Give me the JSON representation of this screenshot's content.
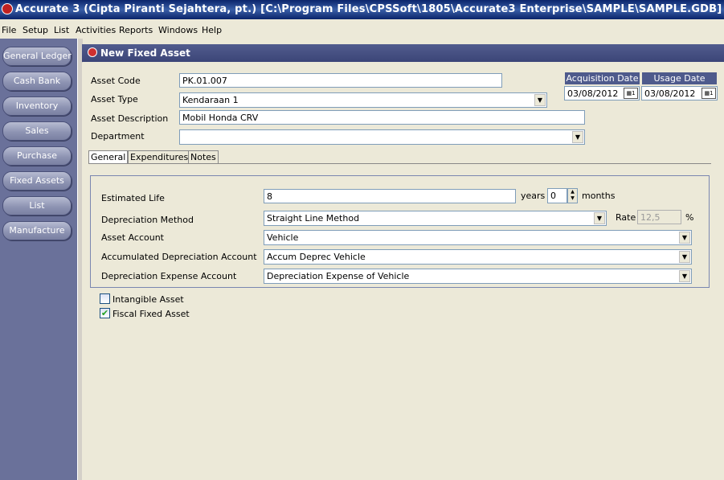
{
  "window": {
    "title": "Accurate 3  (Cipta Piranti Sejahtera, pt.)  [C:\\Program Files\\CPSSoft\\1805\\Accurate3 Enterprise\\SAMPLE\\SAMPLE.GDB]"
  },
  "menu": [
    "File",
    "Setup",
    "List",
    "Activities",
    "Reports",
    "Windows",
    "Help"
  ],
  "sidebar": {
    "items": [
      "General Ledger",
      "Cash Bank",
      "Inventory",
      "Sales",
      "Purchase",
      "Fixed Assets",
      "List",
      "Manufacture"
    ]
  },
  "form": {
    "title": "New Fixed Asset",
    "asset_code_label": "Asset Code",
    "asset_code": "PK.01.007",
    "asset_type_label": "Asset Type",
    "asset_type": "Kendaraan 1",
    "asset_description_label": "Asset Description",
    "asset_description": "Mobil Honda CRV",
    "department_label": "Department",
    "department": "",
    "acquisition_date_label": "Acquisition Date",
    "acquisition_date": "03/08/2012",
    "usage_date_label": "Usage Date",
    "usage_date": "03/08/2012",
    "tabs": [
      "General",
      "Expenditures",
      "Notes"
    ],
    "general": {
      "estimated_life_label": "Estimated Life",
      "estimated_life_years": "8",
      "years_label": "years",
      "estimated_life_months": "0",
      "months_label": "months",
      "depreciation_method_label": "Depreciation Method",
      "depreciation_method": "Straight Line Method",
      "rate_label": "Rate",
      "rate": "12,5",
      "percent_sign": "%",
      "asset_account_label": "Asset Account",
      "asset_account": "Vehicle",
      "accum_depr_label": "Accumulated Depreciation Account",
      "accum_depr_account": "Accum Deprec Vehicle",
      "depr_expense_label": "Depreciation Expense Account",
      "depr_expense_account": "Depreciation Expense of Vehicle"
    },
    "intangible_label": "Intangible Asset",
    "intangible_checked": false,
    "fiscal_label": "Fiscal Fixed Asset",
    "fiscal_checked": true
  },
  "icons": {
    "app": "accurate-app-icon",
    "child": "fixed-asset-window-icon",
    "calendar": "calendar-icon",
    "dropdown": "chevron-down-icon"
  },
  "colors": {
    "title_bar": "#0a246a",
    "sidebar": "#6a719a",
    "child_title": "#3c4578",
    "date_header": "#4e5a8c"
  }
}
